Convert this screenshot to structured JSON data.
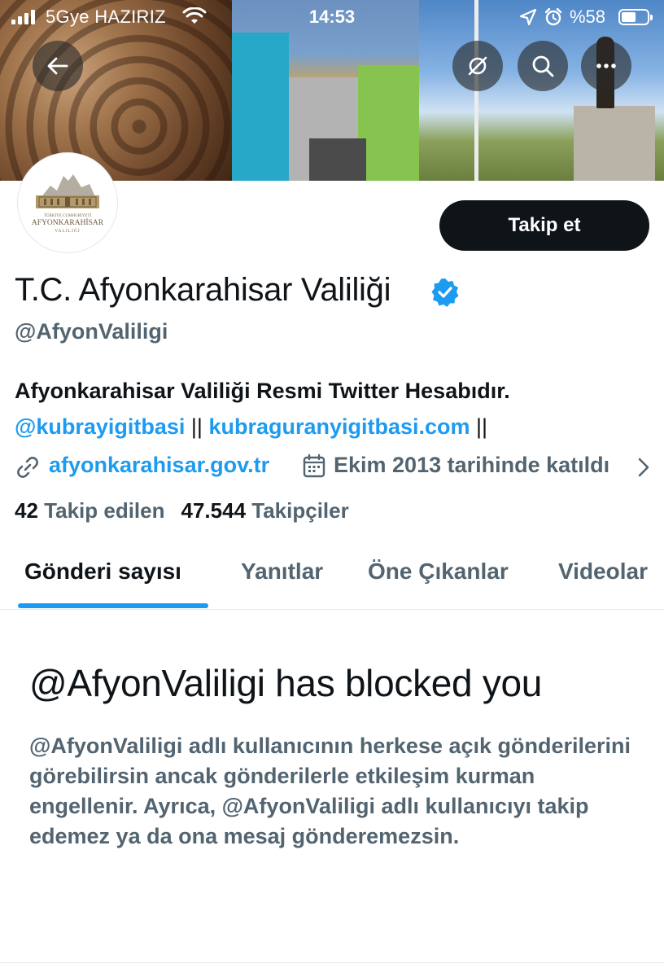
{
  "status_bar": {
    "carrier": "5Gye HAZIRIZ",
    "time": "14:53",
    "battery_pct": "%58",
    "battery_level": 0.58
  },
  "header": {
    "icons": [
      "back-arrow-icon",
      "cursor-off-icon",
      "search-icon",
      "more-icon"
    ]
  },
  "profile": {
    "avatar_lines": [
      "TÜRKİYE CUMHURİYETİ",
      "AFYONKARAHİSAR",
      "VALİLİĞİ"
    ],
    "follow_label": "Takip et",
    "display_name": "T.C. Afyonkarahisar Valiliği",
    "handle": "@AfyonValiligi",
    "bio_text": "Afyonkarahisar Valiliği Resmi Twitter Hesabıdır.",
    "bio_link1": "@kubrayigitbasi",
    "bio_link2": "kubraguranyigitbasi.com",
    "bio_sep": "||",
    "website": "afyonkarahisar.gov.tr",
    "joined": "Ekim 2013 tarihinde katıldı",
    "following_count": "42",
    "following_label": "Takip edilen",
    "followers_count": "47.544",
    "followers_label": "Takipçiler"
  },
  "tabs": [
    {
      "label": "Gönderi sayısı",
      "active": true
    },
    {
      "label": "Yanıtlar",
      "active": false
    },
    {
      "label": "Öne Çıkanlar",
      "active": false
    },
    {
      "label": "Videolar",
      "active": false
    }
  ],
  "blocked": {
    "title": "@AfyonValiligi has blocked you",
    "body": "@AfyonValiligi adlı kullanıcının herkese açık gönderilerini görebilirsin ancak gönderilerle etkileşim kurman engellenir. Ayrıca, @AfyonValiligi adlı kullanıcıyı takip edemez ya da ona mesaj gönderemezsin."
  },
  "colors": {
    "accent": "#1d9bf0",
    "text_primary": "#0f1419",
    "text_secondary": "#536471",
    "button_bg": "#0f1419"
  }
}
